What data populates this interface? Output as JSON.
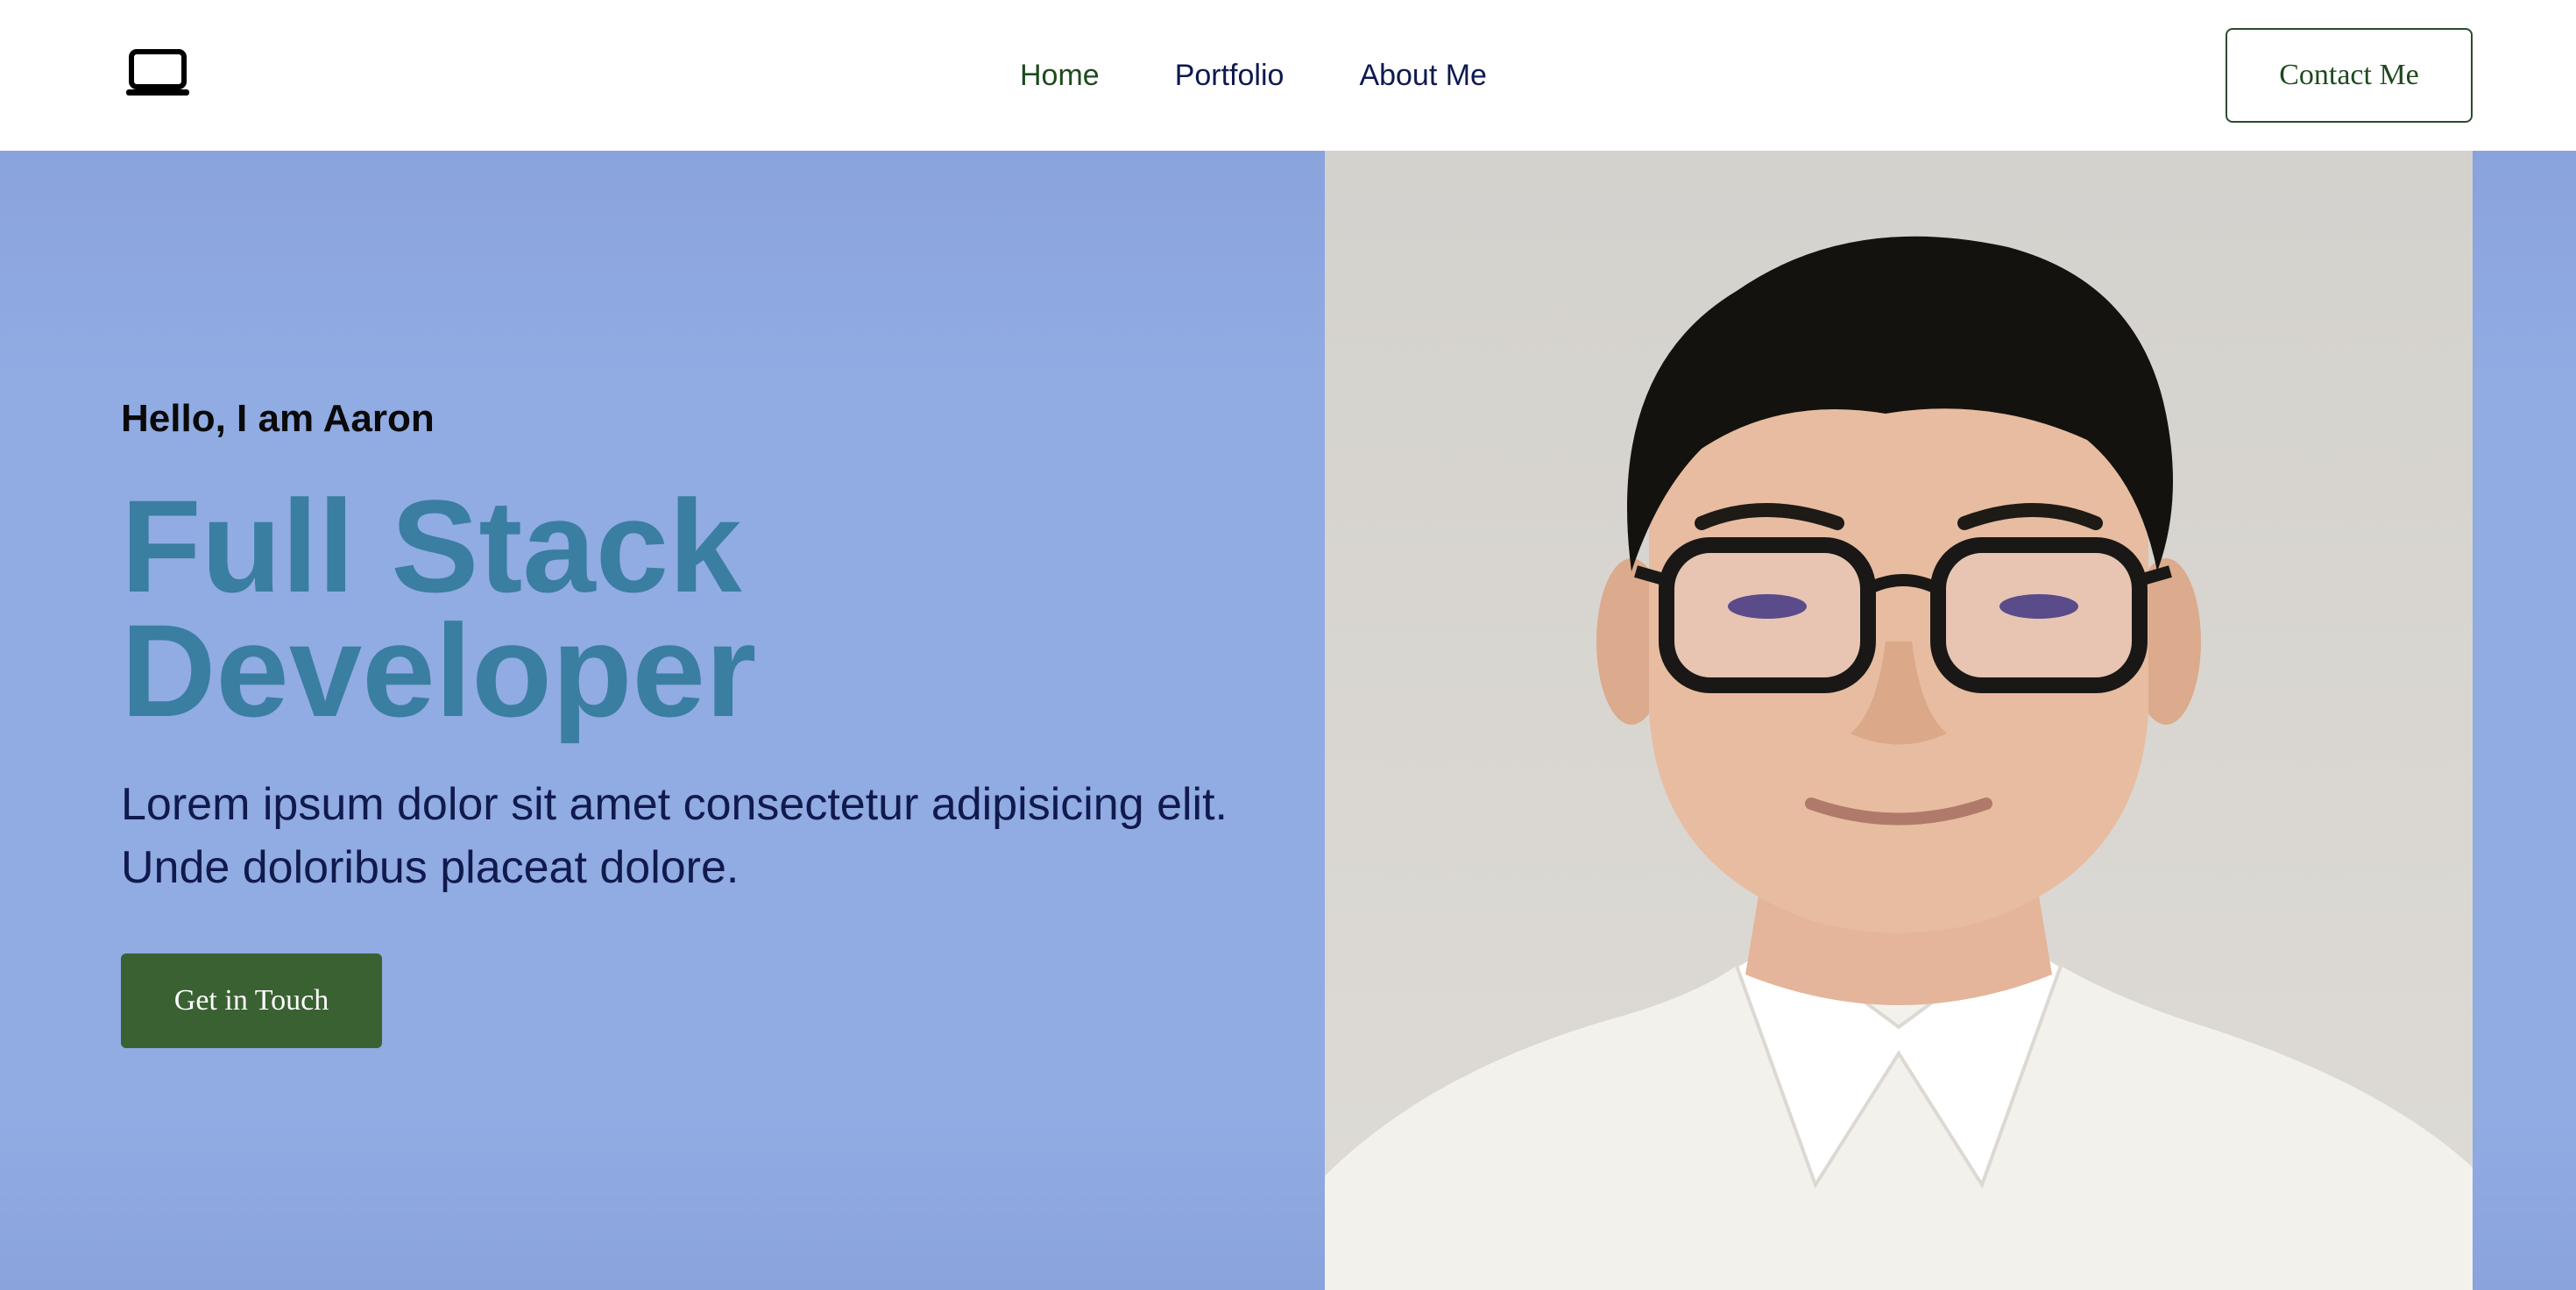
{
  "header": {
    "logo_icon": "laptop-icon",
    "nav": [
      {
        "label": "Home",
        "color": "#1f4a1f"
      },
      {
        "label": "Portfolio",
        "color": "#0e1a4f"
      },
      {
        "label": "About Me",
        "color": "#0e1a4f"
      }
    ],
    "contact_label": "Contact Me"
  },
  "hero": {
    "greeting": "Hello, I am Aaron",
    "title_line1": "Full Stack",
    "title_line2": "Developer",
    "description": "Lorem ipsum dolor sit amet consectetur adipisicing elit. Unde doloribus placeat dolore.",
    "cta_label": "Get in Touch",
    "background_color": "#91abe3",
    "title_color": "#3a7ea2",
    "cta_color": "#3a6132"
  },
  "portrait": {
    "subject": "portrait-photo"
  }
}
